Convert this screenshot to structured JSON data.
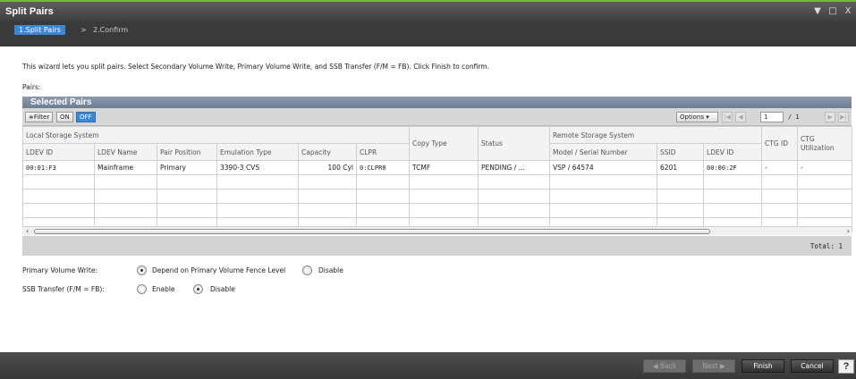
{
  "window": {
    "title": "Split Pairs",
    "controls": [
      "▼",
      "□",
      "X"
    ]
  },
  "steps": {
    "active": "1.Split Pairs",
    "separator": ">",
    "next": "2.Confirm"
  },
  "intro_text": "This wizard lets you split pairs. Select Secondary Volume Write, Primary Volume Write, and SSB Transfer (F/M = FB). Click Finish to confirm.",
  "pairs_label": "Pairs:",
  "selected_pairs": {
    "title": "Selected Pairs",
    "toolbar": {
      "filter": "≑Filter",
      "on": "ON",
      "off": "OFF",
      "options": "Options ▾",
      "page": "1",
      "page_total": "/ 1"
    },
    "group_headers": {
      "local": "Local Storage System",
      "copy_type": "Copy Type",
      "status": "Status",
      "remote": "Remote Storage System",
      "ctg_id": "CTG ID",
      "ctg_util": "CTG Utilization"
    },
    "columns": {
      "ldev_id": "LDEV ID",
      "ldev_name": "LDEV Name",
      "pair_position": "Pair Position",
      "emulation_type": "Emulation Type",
      "capacity": "Capacity",
      "clpr": "CLPR",
      "model_serial": "Model / Serial Number",
      "ssid": "SSID",
      "remote_ldev_id": "LDEV ID"
    },
    "row": {
      "ldev_id": "00:01:F3",
      "ldev_name": "Mainframe",
      "pair_position": "Primary",
      "emulation_type": "3390-3 CVS",
      "capacity": "100 Cyl",
      "clpr": "0:CLPR0",
      "copy_type": "TCMF",
      "status": "PENDING / ...",
      "model_serial": "VSP / 64574",
      "ssid": "6201",
      "remote_ldev_id": "00:00:2F",
      "ctg_id": "-",
      "ctg_util": "-"
    },
    "total": "Total:  1"
  },
  "primary_volume_write": {
    "label": "Primary Volume Write:",
    "options": [
      "Depend on Primary Volume Fence Level",
      "Disable"
    ],
    "selected": "Depend on Primary Volume Fence Level"
  },
  "ssb_transfer": {
    "label": "SSB Transfer (F/M = FB):",
    "options": [
      "Enable",
      "Disable"
    ],
    "selected": "Disable"
  },
  "footer": {
    "back": "◀ Back",
    "next": "Next ▶",
    "finish": "Finish",
    "cancel": "Cancel",
    "help": "?"
  }
}
